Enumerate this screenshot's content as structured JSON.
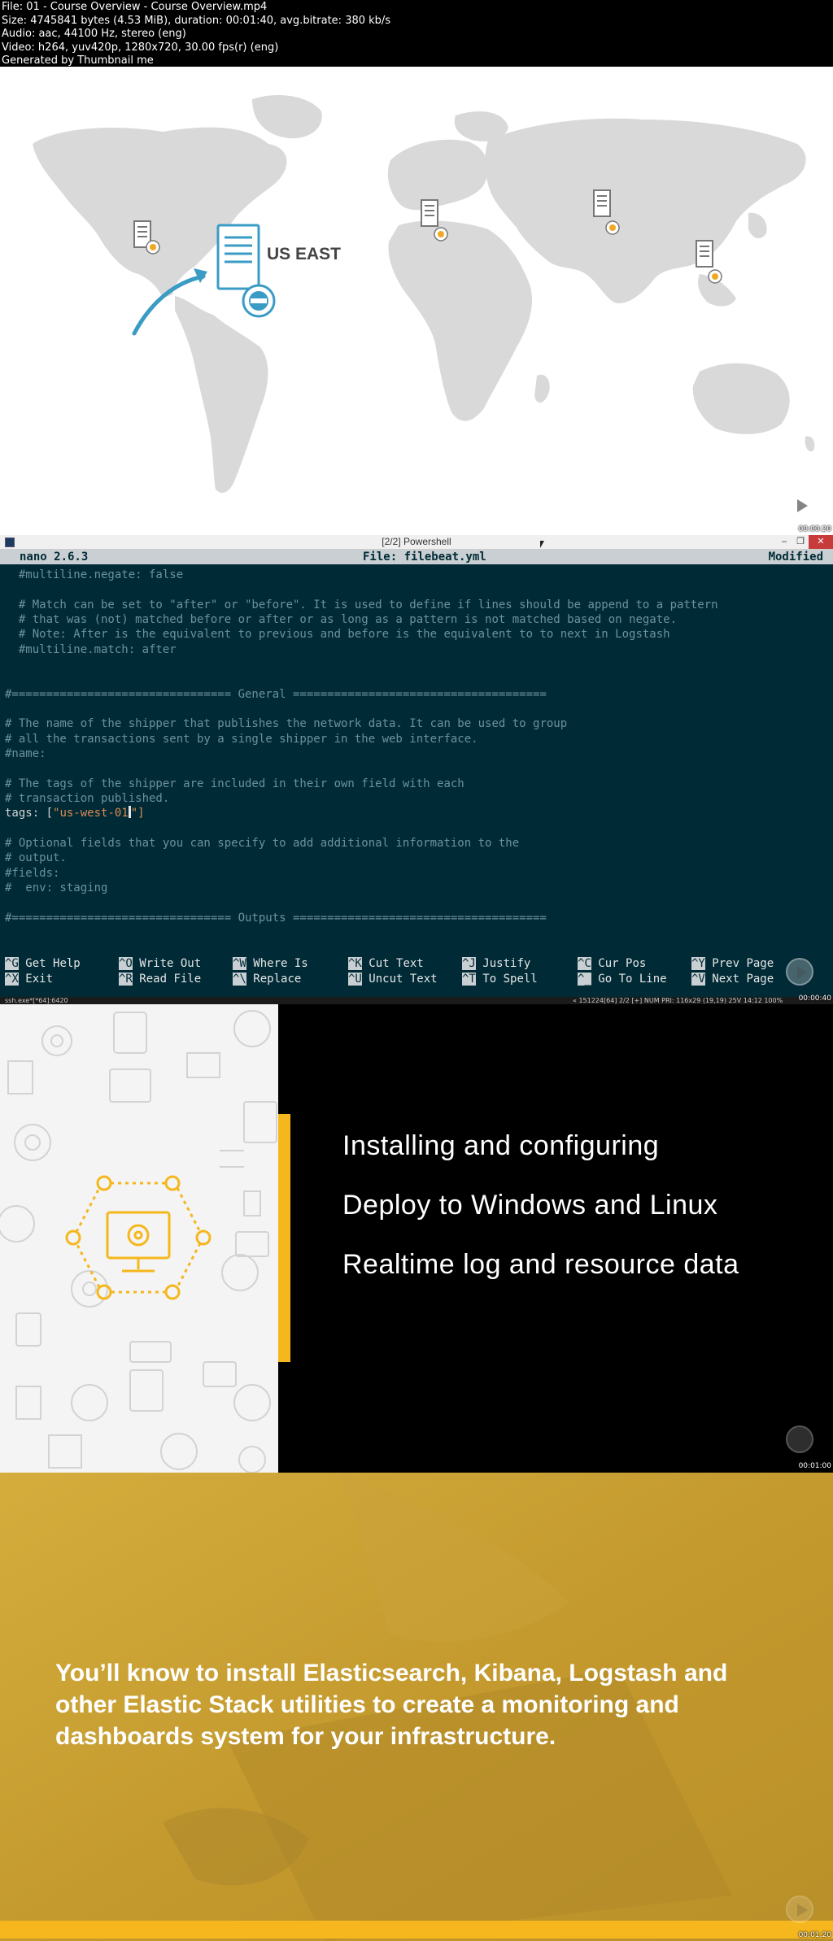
{
  "meta": {
    "file": "File: 01 - Course Overview - Course Overview.mp4",
    "size": "Size: 4745841 bytes (4.53 MiB), duration: 00:01:40, avg.bitrate: 380 kb/s",
    "audio": "Audio: aac, 44100 Hz, stereo (eng)",
    "video": "Video: h264, yuv420p, 1280x720, 30.00 fps(r) (eng)",
    "generated": "Generated by Thumbnail me"
  },
  "frame1": {
    "label": "US EAST",
    "timestamp": "00:00:20"
  },
  "frame2": {
    "window_title": "[2/2] Powershell",
    "nano_version": "nano 2.6.3",
    "file_label": "File: filebeat.yml",
    "modified": "Modified",
    "lines": [
      "  #multiline.negate: false",
      "",
      "  # Match can be set to \"after\" or \"before\". It is used to define if lines should be append to a pattern",
      "  # that was (not) matched before or after or as long as a pattern is not matched based on negate.",
      "  # Note: After is the equivalent to previous and before is the equivalent to to next in Logstash",
      "  #multiline.match: after",
      "",
      "",
      "#================================ General =====================================",
      "",
      "# The name of the shipper that publishes the network data. It can be used to group",
      "# all the transactions sent by a single shipper in the web interface.",
      "#name:",
      "",
      "# The tags of the shipper are included in their own field with each",
      "# transaction published."
    ],
    "tags_key": "tags: [",
    "tags_value": "\"us-west-01",
    "tags_end": "\"]",
    "lines_after": [
      "",
      "# Optional fields that you can specify to add additional information to the",
      "# output.",
      "#fields:",
      "#  env: staging",
      "",
      "#================================ Outputs ====================================="
    ],
    "shortcuts": [
      {
        "key": "^G",
        "label": "Get Help"
      },
      {
        "key": "^O",
        "label": "Write Out"
      },
      {
        "key": "^W",
        "label": "Where Is"
      },
      {
        "key": "^K",
        "label": "Cut Text"
      },
      {
        "key": "^J",
        "label": "Justify"
      },
      {
        "key": "^C",
        "label": "Cur Pos"
      },
      {
        "key": "^Y",
        "label": "Prev Page"
      },
      {
        "key": "^X",
        "label": "Exit"
      },
      {
        "key": "^R",
        "label": "Read File"
      },
      {
        "key": "^\\",
        "label": "Replace"
      },
      {
        "key": "^U",
        "label": "Uncut Text"
      },
      {
        "key": "^T",
        "label": "To Spell"
      },
      {
        "key": "^_",
        "label": "Go To Line"
      },
      {
        "key": "^V",
        "label": "Next Page"
      }
    ],
    "status_left": "ssh.exe*[*64]:6420",
    "status_right": "« 151224[64]   2/2   [+] NUM   PRI:   116x29    (19,19) 25V    14:12   100%",
    "timestamp": "00:00:40"
  },
  "frame3": {
    "bullets": [
      "Installing and configuring",
      "Deploy to Windows and Linux",
      "Realtime log and resource data"
    ],
    "timestamp": "00:01:00"
  },
  "frame4": {
    "quote": "You’ll know to install Elasticsearch, Kibana, Logstash and other Elastic Stack utilities to create a monitoring and dashboards system for your infrastructure.",
    "timestamp": "00:01:20"
  },
  "colors": {
    "accent_yellow": "#f5b71d",
    "map_blue": "#3a9cc5",
    "terminal_bg": "#002b36"
  }
}
